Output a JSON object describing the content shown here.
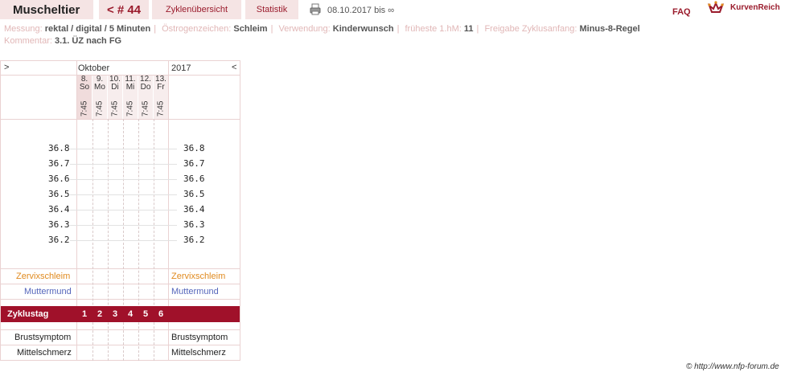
{
  "header": {
    "name": "Muscheltier",
    "cycle_number": "< # 44",
    "tab_cycles": "Zyklenübersicht",
    "tab_stats": "Statistik",
    "date_range": "08.10.2017 bis ∞",
    "faq": "FAQ",
    "brand": "KurvenReich"
  },
  "meta": {
    "messung_label": "Messung:",
    "messung_value": "rektal / digital / 5 Minuten",
    "oestrogen_label": "Östrogenzeichen:",
    "oestrogen_value": "Schleim",
    "verwendung_label": "Verwendung:",
    "verwendung_value": "Kinderwunsch",
    "hm_label": "früheste 1.hM:",
    "hm_value": "11",
    "freigabe_label": "Freigabe Zyklusanfang:",
    "freigabe_value": "Minus-8-Regel",
    "kommentar_label": "Kommentar:",
    "kommentar_value": "3.1. ÜZ nach FG"
  },
  "chart": {
    "nav_prev": ">",
    "nav_next": "<",
    "month": "Oktober",
    "year": "2017",
    "days": [
      {
        "date": "8.",
        "weekday": "So",
        "time": "7:45",
        "cycle_day": "1"
      },
      {
        "date": "9.",
        "weekday": "Mo",
        "time": "7:45",
        "cycle_day": "2"
      },
      {
        "date": "10.",
        "weekday": "Di",
        "time": "7:45",
        "cycle_day": "3"
      },
      {
        "date": "11.",
        "weekday": "Mi",
        "time": "7:45",
        "cycle_day": "4"
      },
      {
        "date": "12.",
        "weekday": "Do",
        "time": "7:45",
        "cycle_day": "5"
      },
      {
        "date": "13.",
        "weekday": "Fr",
        "time": "7:45",
        "cycle_day": "6"
      }
    ],
    "temps": [
      "36.8",
      "36.7",
      "36.6",
      "36.5",
      "36.4",
      "36.3",
      "36.2"
    ],
    "row_zervix": "Zervixschleim",
    "row_mutter": "Muttermund",
    "row_zyklustag": "Zyklustag",
    "row_brust": "Brustsymptom",
    "row_mittel": "Mittelschmerz"
  },
  "colors": {
    "accent": "#9a1b2c",
    "band": "#a0112a",
    "zervix": "#e08a1e",
    "muttermund": "#5566bb"
  },
  "footer": {
    "copyright": "© http://www.nfp-forum.de"
  }
}
